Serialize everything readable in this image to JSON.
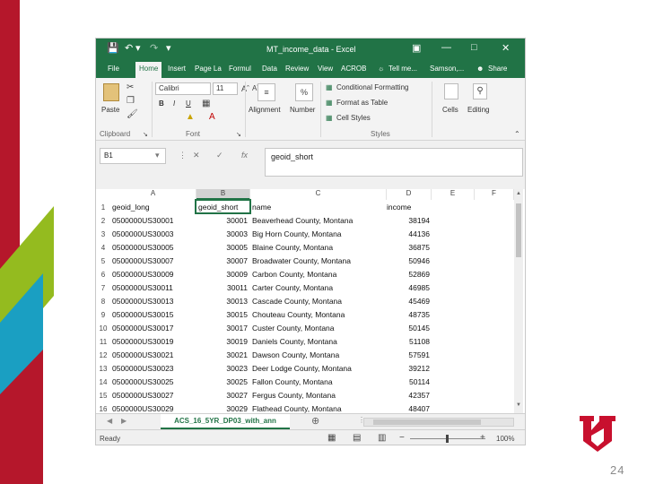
{
  "window": {
    "title": "MT_income_data - Excel"
  },
  "tabs": [
    "File",
    "Home",
    "Insert",
    "Page La",
    "Formul",
    "Data",
    "Review",
    "View",
    "ACROB",
    "Tell me...",
    "Samson,...",
    "Share"
  ],
  "ribbon": {
    "paste": "Paste",
    "font_name": "Calibri",
    "font_size": "11",
    "bold": "B",
    "italic": "I",
    "underline": "U",
    "alignment": "Alignment",
    "number": "Number",
    "percent": "%",
    "conditional_formatting": "Conditional Formatting",
    "format_as_table": "Format as Table",
    "cell_styles": "Cell Styles",
    "cells": "Cells",
    "editing": "Editing",
    "groups": {
      "clipboard": "Clipboard",
      "font": "Font",
      "styles": "Styles"
    }
  },
  "formula_bar": {
    "name_box": "B1",
    "formula": "geoid_short",
    "fx": "fx"
  },
  "grid": {
    "columns": [
      "A",
      "B",
      "C",
      "D",
      "E",
      "F"
    ],
    "rows": [
      {
        "n": "1",
        "a": "geoid_long",
        "b": "geoid_short",
        "c": "name",
        "d": "income"
      },
      {
        "n": "2",
        "a": "0500000US30001",
        "b": "30001",
        "c": "Beaverhead County, Montana",
        "d": "38194"
      },
      {
        "n": "3",
        "a": "0500000US30003",
        "b": "30003",
        "c": "Big Horn County, Montana",
        "d": "44136"
      },
      {
        "n": "4",
        "a": "0500000US30005",
        "b": "30005",
        "c": "Blaine County, Montana",
        "d": "36875"
      },
      {
        "n": "5",
        "a": "0500000US30007",
        "b": "30007",
        "c": "Broadwater County, Montana",
        "d": "50946"
      },
      {
        "n": "6",
        "a": "0500000US30009",
        "b": "30009",
        "c": "Carbon County, Montana",
        "d": "52869"
      },
      {
        "n": "7",
        "a": "0500000US30011",
        "b": "30011",
        "c": "Carter County, Montana",
        "d": "46985"
      },
      {
        "n": "8",
        "a": "0500000US30013",
        "b": "30013",
        "c": "Cascade County, Montana",
        "d": "45469"
      },
      {
        "n": "9",
        "a": "0500000US30015",
        "b": "30015",
        "c": "Chouteau County, Montana",
        "d": "48735"
      },
      {
        "n": "10",
        "a": "0500000US30017",
        "b": "30017",
        "c": "Custer County, Montana",
        "d": "50145"
      },
      {
        "n": "11",
        "a": "0500000US30019",
        "b": "30019",
        "c": "Daniels County, Montana",
        "d": "51108"
      },
      {
        "n": "12",
        "a": "0500000US30021",
        "b": "30021",
        "c": "Dawson County, Montana",
        "d": "57591"
      },
      {
        "n": "13",
        "a": "0500000US30023",
        "b": "30023",
        "c": "Deer Lodge County, Montana",
        "d": "39212"
      },
      {
        "n": "14",
        "a": "0500000US30025",
        "b": "30025",
        "c": "Fallon County, Montana",
        "d": "50114"
      },
      {
        "n": "15",
        "a": "0500000US30027",
        "b": "30027",
        "c": "Fergus County, Montana",
        "d": "42357"
      },
      {
        "n": "16",
        "a": "0500000US30029",
        "b": "30029",
        "c": "Flathead County, Montana",
        "d": "48407"
      }
    ]
  },
  "sheet_tab": "ACS_16_5YR_DP03_with_ann",
  "status": {
    "ready": "Ready",
    "zoom": "100%"
  },
  "slide": {
    "page_number": "24"
  },
  "colors": {
    "excel_green": "#217346",
    "accent_red": "#b5172b",
    "accent_green": "#94bb1f",
    "accent_blue": "#1a9fc2"
  }
}
